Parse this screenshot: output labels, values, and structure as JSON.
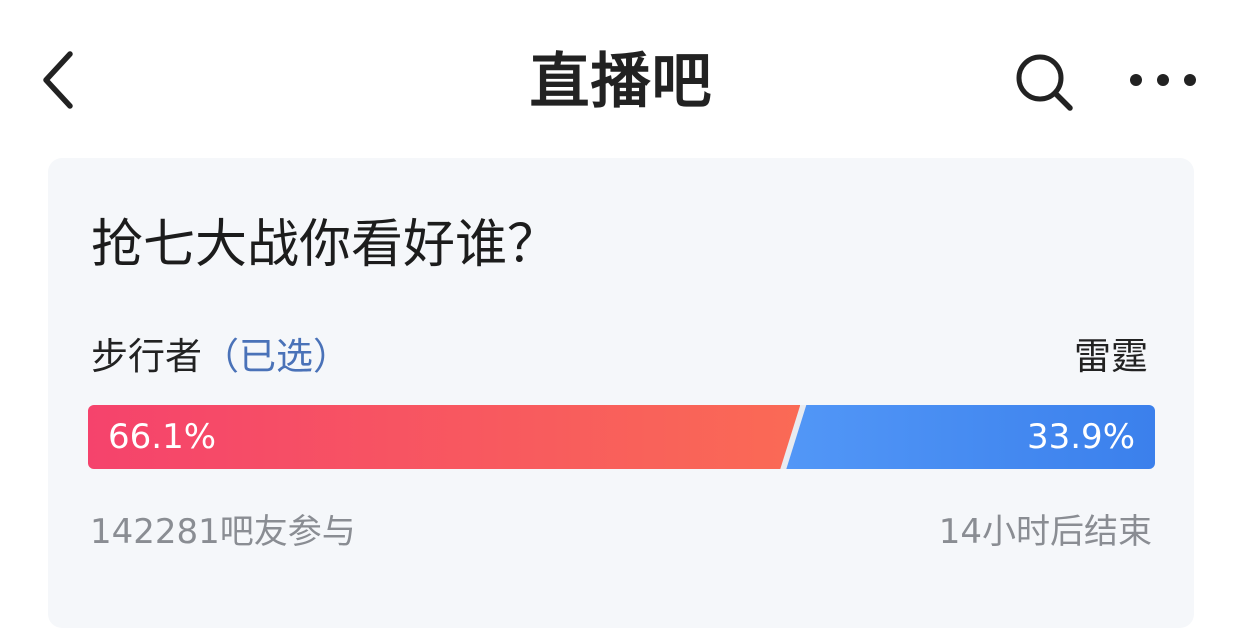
{
  "header": {
    "title": "直播吧",
    "back_icon": "chevron-left-icon",
    "search_icon": "search-icon",
    "more_icon": "more-dots-icon"
  },
  "poll": {
    "question": "抢七大战你看好谁？",
    "left_option": {
      "name": "步行者",
      "selected_tag": "（已选）",
      "percent_label": "66.1%",
      "share": 0.661,
      "color_start": "#f5436c",
      "color_end": "#fa6a55"
    },
    "right_option": {
      "name": "雷霆",
      "percent_label": "33.9%",
      "share": 0.339,
      "color_start": "#5297f7",
      "color_end": "#3b80ec"
    },
    "participants": "142281吧友参与",
    "end_time": "14小时后结束"
  },
  "colors": {
    "selected_accent": "#4a72b8",
    "card_background": "#f5f7fa",
    "meta_text": "#8a8d93"
  }
}
